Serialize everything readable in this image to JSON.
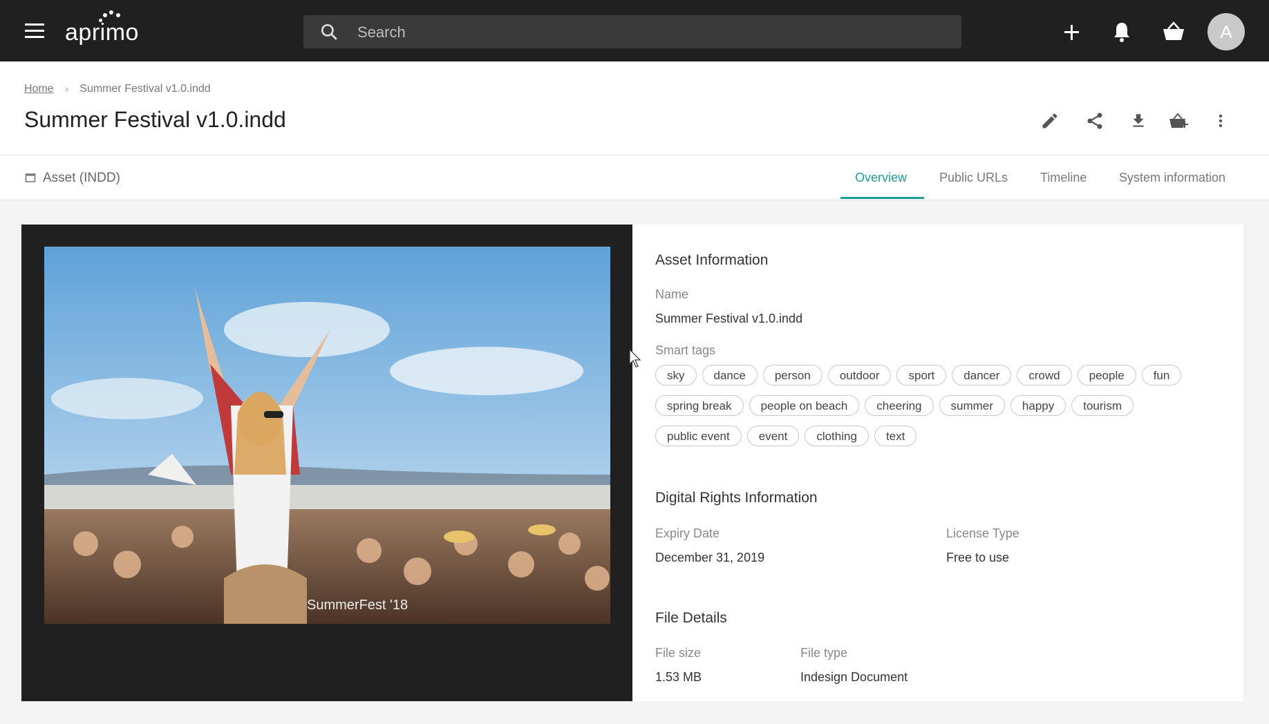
{
  "app": {
    "logo_text": "aprimo"
  },
  "search": {
    "placeholder": "Search"
  },
  "user": {
    "avatar_initial": "A"
  },
  "breadcrumb": {
    "home": "Home",
    "current": "Summer Festival v1.0.indd"
  },
  "page": {
    "title": "Summer Festival v1.0.indd"
  },
  "asset": {
    "type_label": "Asset (INDD)"
  },
  "tabs": [
    {
      "label": "Overview",
      "active": true
    },
    {
      "label": "Public URLs",
      "active": false
    },
    {
      "label": "Timeline",
      "active": false
    },
    {
      "label": "System information",
      "active": false
    }
  ],
  "preview": {
    "caption": "SummerFest '18"
  },
  "asset_info": {
    "title": "Asset Information",
    "name_label": "Name",
    "name_value": "Summer Festival v1.0.indd",
    "smart_tags_label": "Smart tags",
    "smart_tags": [
      "sky",
      "dance",
      "person",
      "outdoor",
      "sport",
      "dancer",
      "crowd",
      "people",
      "fun",
      "spring break",
      "people on beach",
      "cheering",
      "summer",
      "happy",
      "tourism",
      "public event",
      "event",
      "clothing",
      "text"
    ]
  },
  "rights": {
    "title": "Digital Rights Information",
    "expiry_label": "Expiry Date",
    "expiry_value": "December 31, 2019",
    "license_label": "License Type",
    "license_value": "Free to use"
  },
  "file_details": {
    "title": "File Details",
    "size_label": "File size",
    "size_value": "1.53 MB",
    "type_label": "File type",
    "type_value": "Indesign Document"
  },
  "colors": {
    "accent": "#1f9c95",
    "topbar": "#202020"
  }
}
